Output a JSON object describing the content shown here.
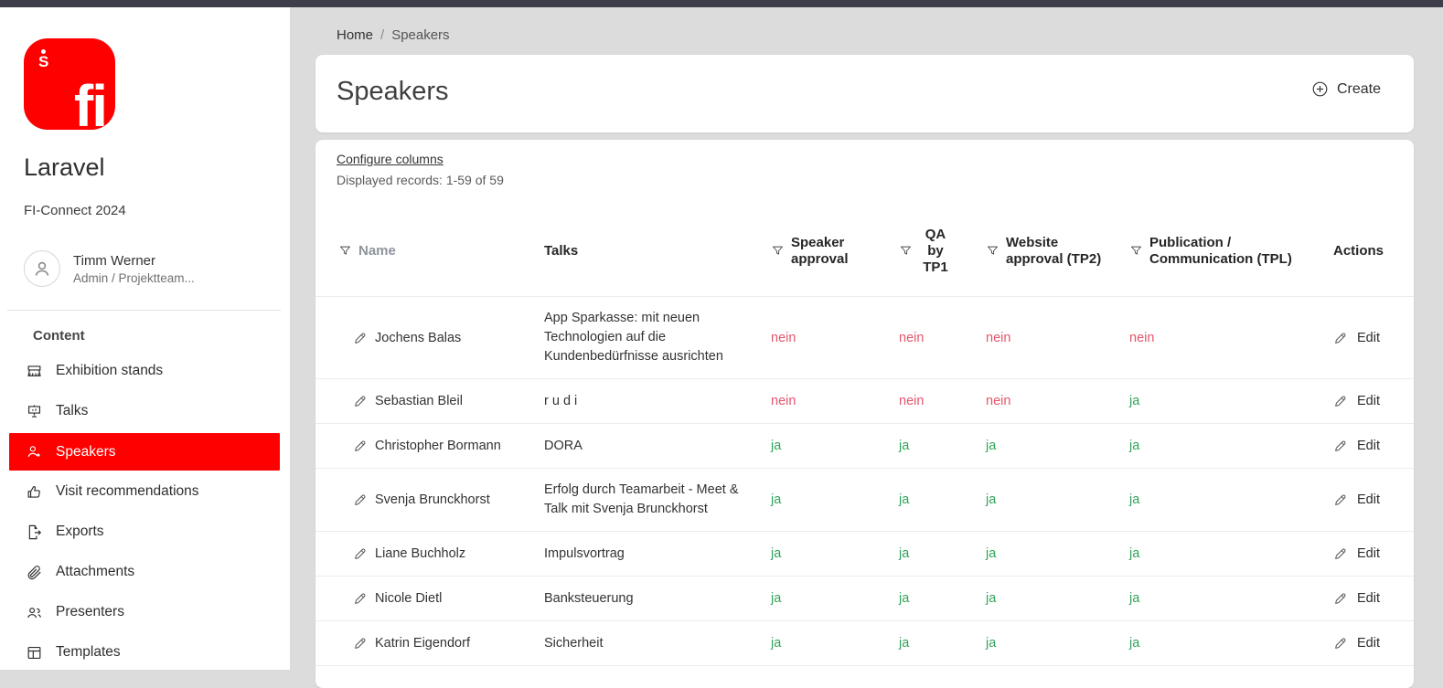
{
  "colors": {
    "accent_red": "#fe0000",
    "yes_green": "#31a35a",
    "no_red": "#e4556b"
  },
  "sidebar": {
    "logo": {
      "icon": "fi-sparkasse-logo",
      "letters": "fi",
      "s_symbol": "S"
    },
    "app_title": "Laravel",
    "app_subtitle": "FI-Connect 2024",
    "user": {
      "name": "Timm Werner",
      "role": "Admin / Projektteam..."
    },
    "section_title": "Content",
    "items": [
      {
        "label": "Exhibition stands",
        "icon": "exhibition-stand-icon",
        "active": false
      },
      {
        "label": "Talks",
        "icon": "presentation-icon",
        "active": false
      },
      {
        "label": "Speakers",
        "icon": "speaker-person-icon",
        "active": true
      },
      {
        "label": "Visit recommendations",
        "icon": "thumbs-up-icon",
        "active": false
      },
      {
        "label": "Exports",
        "icon": "export-icon",
        "active": false
      },
      {
        "label": "Attachments",
        "icon": "paperclip-icon",
        "active": false
      },
      {
        "label": "Presenters",
        "icon": "people-icon",
        "active": false
      },
      {
        "label": "Templates",
        "icon": "template-icon",
        "active": false
      }
    ]
  },
  "breadcrumb": {
    "home": "Home",
    "separator": "/",
    "current": "Speakers"
  },
  "page": {
    "title": "Speakers",
    "create_label": "Create"
  },
  "table_card": {
    "configure_columns_label": "Configure columns",
    "records_info": "Displayed records: 1-59 of 59",
    "columns": [
      {
        "key": "name",
        "label": "Name",
        "filter": true,
        "muted": true,
        "wrap": ""
      },
      {
        "key": "talk",
        "label": "Talks",
        "filter": false,
        "muted": false,
        "wrap": ""
      },
      {
        "key": "speaker",
        "label": "Speaker approval",
        "filter": true,
        "muted": false,
        "wrap": "hwrap-sm"
      },
      {
        "key": "qa",
        "label": "QA by TP1",
        "filter": true,
        "muted": false,
        "wrap": "hnarrow"
      },
      {
        "key": "website",
        "label": "Website approval (TP2)",
        "filter": true,
        "muted": false,
        "wrap": "hwrap-sm"
      },
      {
        "key": "publication",
        "label": "Publication / Communication (TPL)",
        "filter": true,
        "muted": false,
        "wrap": "hwrap-md"
      },
      {
        "key": "actions",
        "label": "Actions",
        "filter": false,
        "muted": false,
        "wrap": ""
      }
    ],
    "edit_label": "Edit",
    "rows": [
      {
        "name": "Jochens Balas",
        "talk": "App Sparkasse: mit neuen Technologien auf die Kundenbedürfnisse ausrichten",
        "speaker": "nein",
        "qa": "nein",
        "website": "nein",
        "publication": "nein"
      },
      {
        "name": "Sebastian Bleil",
        "talk": "r u d i",
        "speaker": "nein",
        "qa": "nein",
        "website": "nein",
        "publication": "ja"
      },
      {
        "name": "Christopher Bormann",
        "talk": "DORA",
        "speaker": "ja",
        "qa": "ja",
        "website": "ja",
        "publication": "ja"
      },
      {
        "name": "Svenja Brunckhorst",
        "talk": "Erfolg durch Teamarbeit - Meet & Talk mit Svenja Brunckhorst",
        "speaker": "ja",
        "qa": "ja",
        "website": "ja",
        "publication": "ja"
      },
      {
        "name": "Liane Buchholz",
        "talk": "Impulsvortrag",
        "speaker": "ja",
        "qa": "ja",
        "website": "ja",
        "publication": "ja"
      },
      {
        "name": "Nicole Dietl",
        "talk": "Banksteuerung",
        "speaker": "ja",
        "qa": "ja",
        "website": "ja",
        "publication": "ja"
      },
      {
        "name": "Katrin Eigendorf",
        "talk": "Sicherheit",
        "speaker": "ja",
        "qa": "ja",
        "website": "ja",
        "publication": "ja"
      }
    ]
  }
}
